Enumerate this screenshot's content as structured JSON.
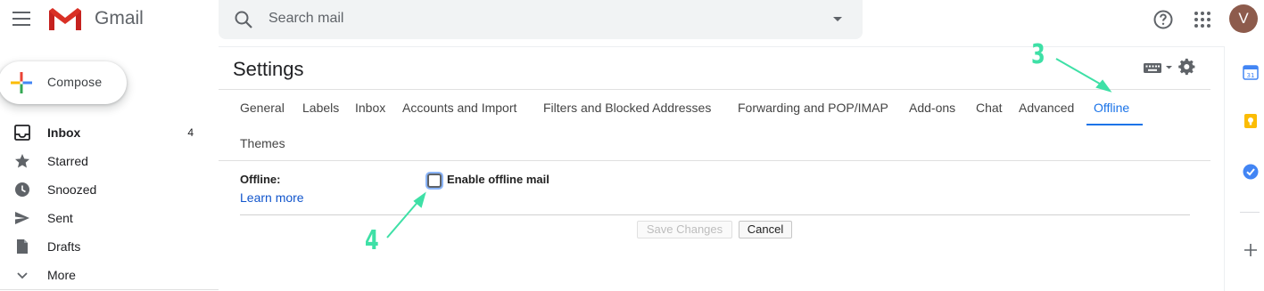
{
  "app": {
    "brand": "Gmail",
    "avatar_letter": "V"
  },
  "search": {
    "placeholder": "Search mail"
  },
  "compose": {
    "label": "Compose"
  },
  "sidebar": {
    "items": [
      {
        "label": "Inbox",
        "count": "4",
        "icon": "inbox-icon",
        "active": true
      },
      {
        "label": "Starred",
        "count": "",
        "icon": "star-icon"
      },
      {
        "label": "Snoozed",
        "count": "",
        "icon": "clock-icon"
      },
      {
        "label": "Sent",
        "count": "",
        "icon": "send-icon"
      },
      {
        "label": "Drafts",
        "count": "",
        "icon": "draft-icon"
      },
      {
        "label": "More",
        "count": "",
        "icon": "chevron-down-icon"
      }
    ]
  },
  "settings": {
    "title": "Settings",
    "tabs": [
      {
        "label": "General"
      },
      {
        "label": "Labels"
      },
      {
        "label": "Inbox"
      },
      {
        "label": "Accounts and Import"
      },
      {
        "label": "Filters and Blocked Addresses"
      },
      {
        "label": "Forwarding and POP/IMAP"
      },
      {
        "label": "Add-ons"
      },
      {
        "label": "Chat"
      },
      {
        "label": "Advanced"
      },
      {
        "label": "Offline",
        "active": true
      },
      {
        "label": "Themes"
      }
    ],
    "offline": {
      "label": "Offline:",
      "learn_more": "Learn more",
      "checkbox_label": "Enable offline mail",
      "checked": false
    },
    "buttons": {
      "save": "Save Changes",
      "cancel": "Cancel"
    }
  },
  "annotations": {
    "step3": "3",
    "step4": "4",
    "color": "#3ee0a6"
  },
  "colors": {
    "accent": "#1a73e8",
    "link": "#1155cc"
  }
}
